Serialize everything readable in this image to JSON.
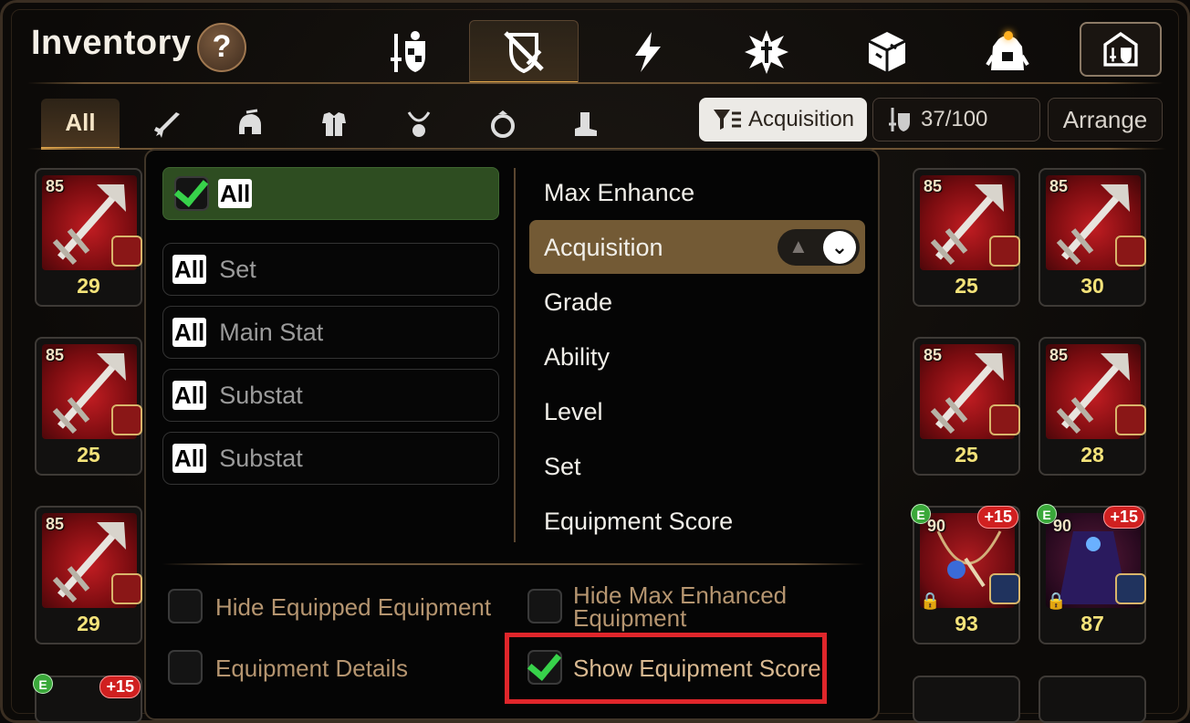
{
  "header": {
    "title": "Inventory",
    "help_label": "?",
    "tabs": [
      {
        "icon": "equipment-icon"
      },
      {
        "icon": "no-equipment-icon",
        "active": true
      },
      {
        "icon": "lightning-icon"
      },
      {
        "icon": "burst-icon"
      },
      {
        "icon": "cube-icon"
      },
      {
        "icon": "bag-icon",
        "notification": true
      },
      {
        "icon": "storage-icon"
      }
    ]
  },
  "filters": {
    "tabs": [
      {
        "label": "All",
        "active": true
      },
      {
        "icon": "sword-icon"
      },
      {
        "icon": "helmet-icon"
      },
      {
        "icon": "armor-icon"
      },
      {
        "icon": "necklace-icon"
      },
      {
        "icon": "ring-icon"
      },
      {
        "icon": "boots-icon"
      }
    ],
    "sort_button": "Acquisition",
    "capacity": "37/100",
    "arrange_button": "Arrange"
  },
  "items": {
    "col1": [
      {
        "level": "85",
        "score": "29"
      },
      {
        "level": "85",
        "score": "25"
      },
      {
        "level": "85",
        "score": "29"
      }
    ],
    "col8": [
      {
        "level": "85",
        "score": "25"
      },
      {
        "level": "85",
        "score": "25"
      },
      {
        "level": "90",
        "score": "93",
        "enhance": "+15",
        "e": "E",
        "locked": true
      }
    ],
    "col9": [
      {
        "level": "85",
        "score": "30"
      },
      {
        "level": "85",
        "score": "28"
      },
      {
        "level": "90",
        "score": "87",
        "enhance": "+15",
        "e": "E",
        "locked": true
      }
    ],
    "bottom_partial": {
      "enhance": "+15",
      "e": "E"
    }
  },
  "dropdown": {
    "all_pill": "All",
    "all_label": "All",
    "filter_rows": [
      {
        "pill": "All",
        "label": "Set"
      },
      {
        "pill": "All",
        "label": "Main Stat"
      },
      {
        "pill": "All",
        "label": "Substat"
      },
      {
        "pill": "All",
        "label": "Substat"
      }
    ],
    "sort_options": [
      "Max Enhance",
      "Acquisition",
      "Grade",
      "Ability",
      "Level",
      "Set",
      "Equipment Score"
    ],
    "sort_selected": "Acquisition",
    "options": {
      "hide_equipped": "Hide Equipped Equipment",
      "hide_max_line1": "Hide Max Enhanced",
      "hide_max_line2": "Equipment",
      "equipment_details": "Equipment Details",
      "show_score": "Show Equipment Score"
    }
  },
  "colors": {
    "accent_gold": "#e0a54a",
    "selected_green": "#2e4d21",
    "selected_sort": "#735a35",
    "highlight_red": "#e0262b",
    "score_yellow": "#f4e37a"
  }
}
